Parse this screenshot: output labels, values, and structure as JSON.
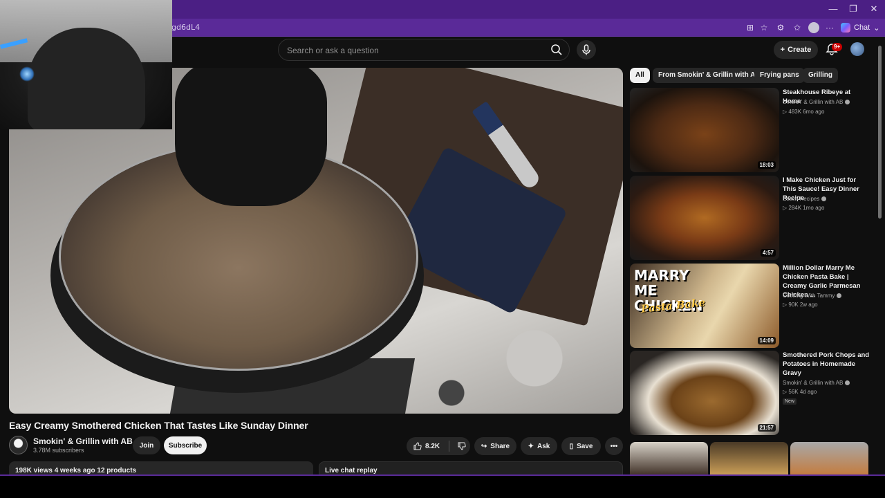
{
  "browser": {
    "url_fragment": "gd6dL4",
    "chat_label": "Chat",
    "more_label": "···"
  },
  "masthead": {
    "search_placeholder": "Search or ask a question",
    "create_label": "Create",
    "notification_count": "9+"
  },
  "video": {
    "title": "Easy Creamy Smothered Chicken That Tastes Like Sunday Dinner",
    "channel": "Smokin' & Grillin with AB",
    "subscribers": "3.78M subscribers",
    "join_label": "Join",
    "subscribe_label": "Subscribe",
    "likes": "8.2K",
    "share_label": "Share",
    "ask_label": "Ask",
    "save_label": "Save",
    "description_summary": "198K views  4 weeks ago  12 products",
    "live_chat_label": "Live chat replay"
  },
  "chips": [
    {
      "label": "All",
      "active": true
    },
    {
      "label": "From Smokin' & Grillin with AB",
      "active": false
    },
    {
      "label": "Frying pans",
      "active": false
    },
    {
      "label": "Grilling",
      "active": false
    }
  ],
  "recommendations": [
    {
      "title": "Steakhouse Ribeye at Home",
      "channel": "Smokin' & Grillin with AB",
      "meta": "483K  6mo ago",
      "duration": "18:03",
      "badge": ""
    },
    {
      "title": "I Make Chicken Just for This Sauce! Easy Dinner Recipe",
      "channel": "Essen Recipes",
      "meta": "284K  1mo ago",
      "duration": "4:57",
      "badge": ""
    },
    {
      "title": "Million Dollar Marry Me Chicken Pasta Bake | Creamy Garlic Parmesan Chicken ...",
      "channel": "Cooking With Tammy",
      "meta": "90K  2w ago",
      "duration": "14:09",
      "badge": "",
      "thumb_text": "MARRY ME CHICKEN",
      "thumb_sub": "Pasta Bake"
    },
    {
      "title": "Smothered Pork Chops and Potatoes in Homemade Gravy",
      "channel": "Smokin' & Grillin with AB",
      "meta": "56K  4d ago",
      "duration": "21:57",
      "badge": "New"
    }
  ],
  "colors": {
    "browser_frame": "#4b1f84",
    "page_bg": "#0f0f0f",
    "badge_red": "#cc0000"
  }
}
